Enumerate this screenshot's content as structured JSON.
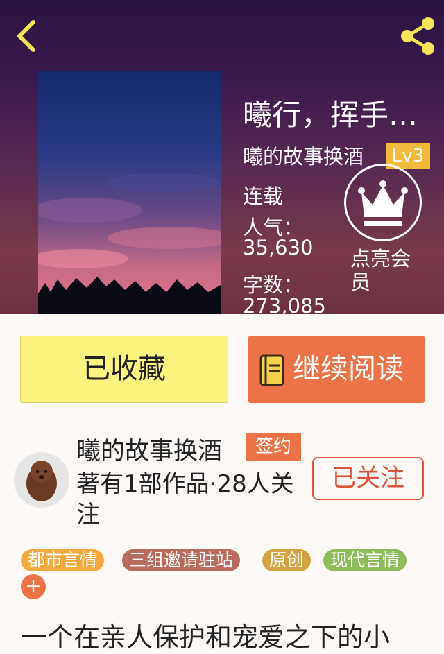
{
  "header": {
    "back_icon": "chevron-left-icon",
    "share_icon": "share-icon"
  },
  "book": {
    "title": "曦行，挥手…",
    "author": "曦的故事换酒",
    "level": "Lv3",
    "status": "连载",
    "popularity_label": "人气：",
    "popularity_value": "35,630",
    "wordcount_label": "字数：",
    "wordcount_value": "273,085"
  },
  "member": {
    "icon": "crown-icon",
    "label": "点亮会员"
  },
  "actions": {
    "favorite_label": "已收藏",
    "read_label": "继续阅读",
    "read_icon": "book-icon"
  },
  "author_card": {
    "name": "曦的故事换酒",
    "badge": "签约",
    "meta": "著有1部作品·28人关注",
    "follow_label": "已关注"
  },
  "tags": [
    {
      "label": "都市言情",
      "color": "#f3a93d"
    },
    {
      "label": "三组邀请驻站",
      "color": "#b96b5c"
    },
    {
      "label": "原创",
      "color": "#d1a343"
    },
    {
      "label": "现代言情",
      "color": "#8bbb5a"
    }
  ],
  "tags_add": "+",
  "description": "一个在亲人保护和宠爱之下的小",
  "colors": {
    "accent": "#ec7247",
    "favorite_bg": "#fbf47e",
    "level_badge": "#f3b93d"
  }
}
